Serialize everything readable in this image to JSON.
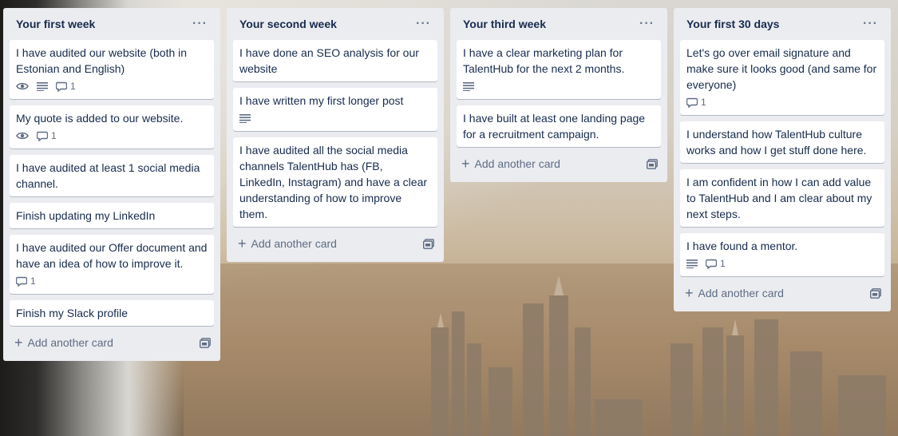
{
  "lists": [
    {
      "title": "Your first week",
      "menu": "···",
      "cards": [
        {
          "text": "I have audited our website (both in Estonian and English)",
          "badges": {
            "watch": true,
            "description": true,
            "comments": "1"
          }
        },
        {
          "text": "My quote is added to our website.",
          "badges": {
            "watch": true,
            "description": false,
            "comments": "1"
          }
        },
        {
          "text": "I have audited at least 1 social media channel.",
          "badges": null
        },
        {
          "text": "Finish updating my LinkedIn",
          "badges": null
        },
        {
          "text": "I have audited our Offer document and have an idea of how to improve it.",
          "badges": {
            "watch": false,
            "description": false,
            "comments": "1"
          }
        },
        {
          "text": "Finish my Slack profile",
          "badges": null
        }
      ],
      "add_label": "Add another card"
    },
    {
      "title": "Your second week",
      "menu": "···",
      "cards": [
        {
          "text": "I have done an SEO analysis for our website",
          "badges": null
        },
        {
          "text": "I have written my first longer post",
          "badges": {
            "watch": false,
            "description": true,
            "comments": null
          }
        },
        {
          "text": "I have audited all the social media channels TalentHub has (FB, LinkedIn, Instagram) and have a clear understanding of how to improve them.",
          "badges": null
        }
      ],
      "add_label": "Add another card"
    },
    {
      "title": "Your third week",
      "menu": "···",
      "cards": [
        {
          "text": "I have a clear marketing plan for TalentHub for the next 2 months.",
          "badges": {
            "watch": false,
            "description": true,
            "comments": null
          }
        },
        {
          "text": "I have built at least one landing page for a recruitment campaign.",
          "badges": null
        }
      ],
      "add_label": "Add another card"
    },
    {
      "title": "Your first 30 days",
      "menu": "···",
      "cards": [
        {
          "text": "Let's go over email signature and make sure it looks good (and same for everyone)",
          "badges": {
            "watch": false,
            "description": false,
            "comments": "1"
          }
        },
        {
          "text": "I understand how TalentHub culture works and how I get stuff done here.",
          "badges": null
        },
        {
          "text": "I am confident in how I can add value to TalentHub and I am clear about my next steps.",
          "badges": null
        },
        {
          "text": "I have found a mentor.",
          "badges": {
            "watch": false,
            "description": true,
            "comments": "1"
          }
        }
      ],
      "add_label": "Add another card"
    }
  ],
  "icons": {
    "watch": "eye-icon",
    "description": "description-lines-icon",
    "comments": "comment-bubble-icon",
    "add": "plus-icon",
    "template": "card-template-icon",
    "menu": "ellipsis-icon"
  }
}
